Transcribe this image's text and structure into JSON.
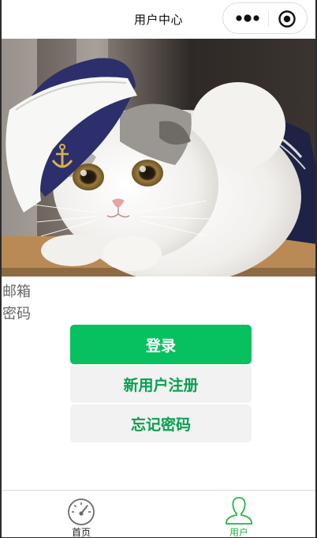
{
  "navbar": {
    "title": "用户中心",
    "more_icon": "more-dots-icon",
    "close_icon": "target-close-icon"
  },
  "hero": {
    "description_icon": "cat-photo"
  },
  "form": {
    "email_label": "邮箱",
    "password_label": "密码"
  },
  "buttons": {
    "login": "登录",
    "register": "新用户注册",
    "forgot": "忘记密码"
  },
  "tabbar": {
    "items": [
      {
        "label": "首页",
        "icon": "dashboard-gauge-icon",
        "active": false
      },
      {
        "label": "用户",
        "icon": "user-icon",
        "active": true
      }
    ]
  },
  "colors": {
    "primary": "#07c160",
    "secondary_text": "#07a04f",
    "secondary_bg": "#f2f2f2",
    "tab_active": "#22b344"
  }
}
